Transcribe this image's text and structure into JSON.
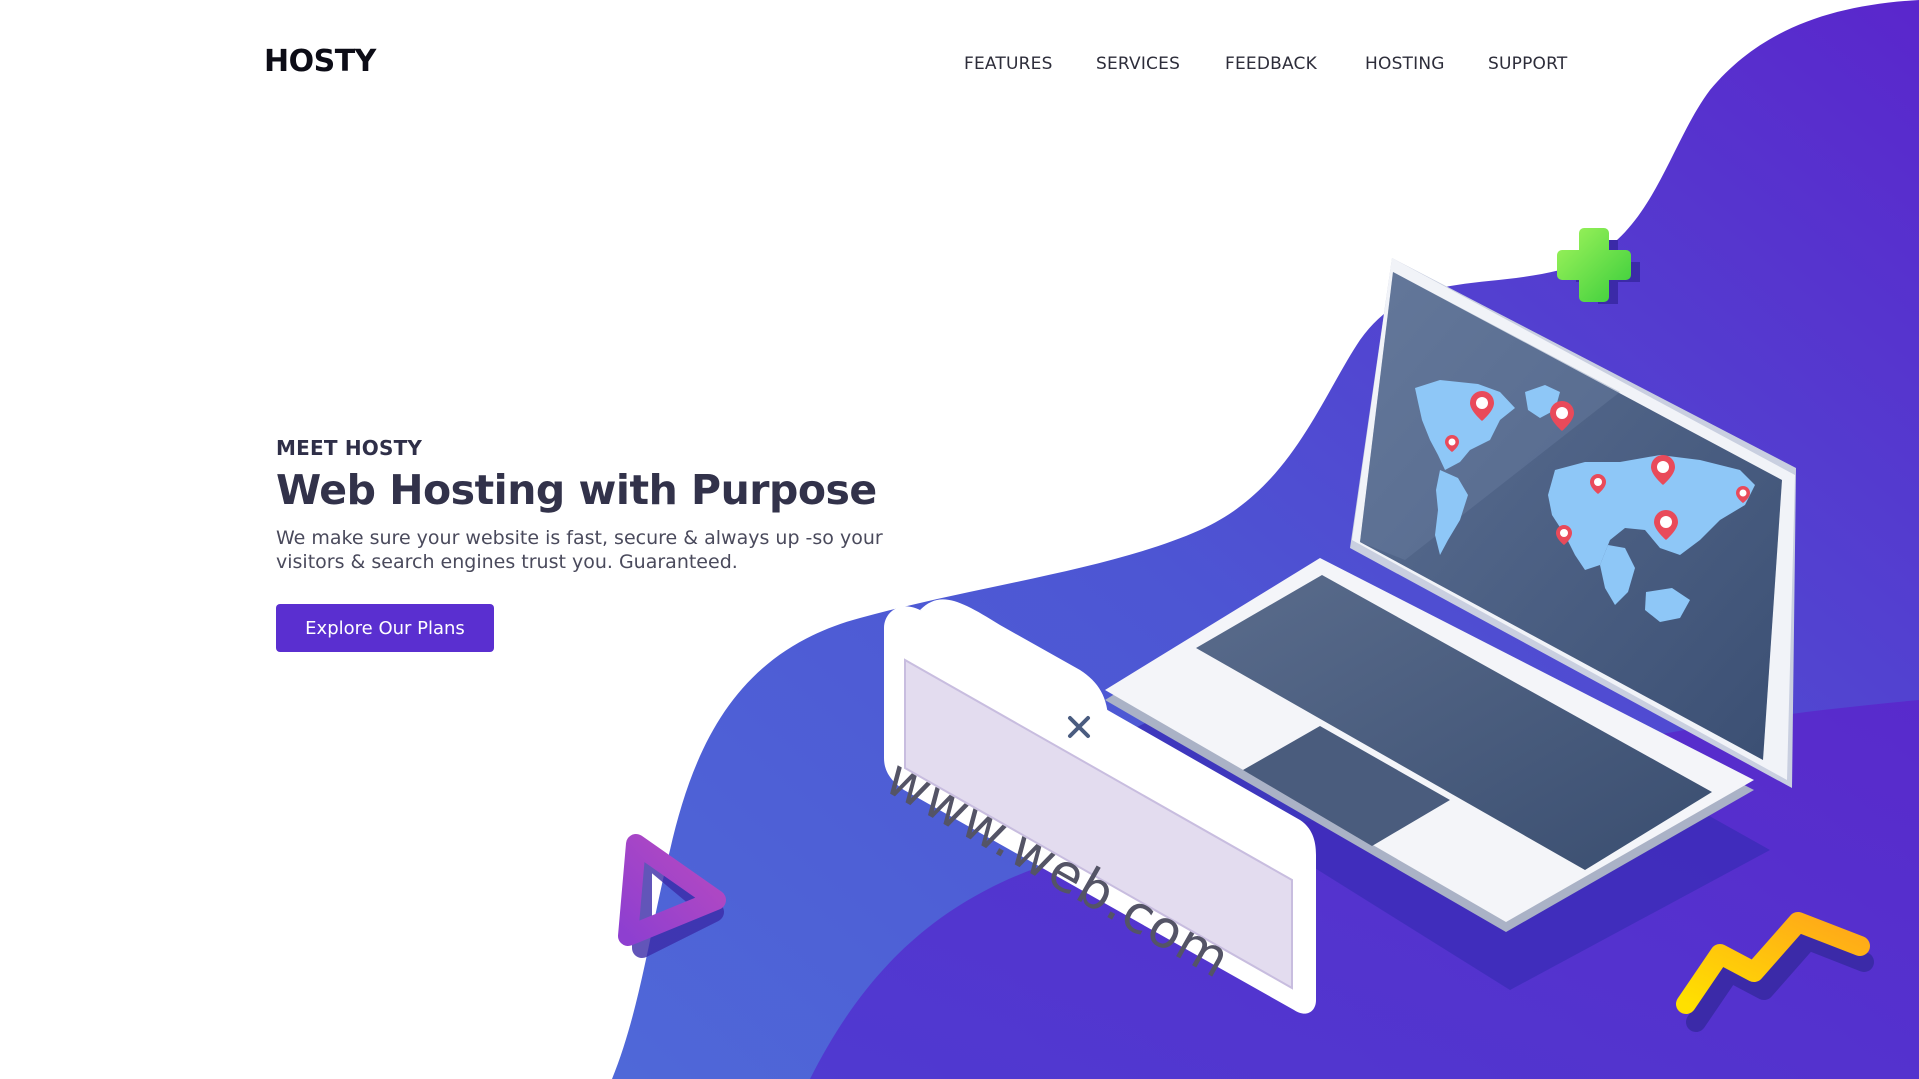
{
  "brand": {
    "name": "HOSTY"
  },
  "nav": {
    "items": [
      {
        "label": "FEATURES"
      },
      {
        "label": "SERVICES"
      },
      {
        "label": "FEEDBACK"
      },
      {
        "label": "HOSTING"
      },
      {
        "label": "SUPPORT"
      }
    ]
  },
  "hero": {
    "eyebrow": "MEET HOSTY",
    "headline": "Web Hosting with Purpose",
    "description": "We make sure your website is fast, secure & always up -so your visitors & search engines trust you. Guaranteed.",
    "cta_label": "Explore Our Plans"
  },
  "illustration": {
    "url_bar_text": "www.web.com",
    "icons": [
      "green-plus-icon",
      "play-triangle-icon",
      "zigzag-icon",
      "close-x-icon",
      "map-pin-icon"
    ]
  },
  "colors": {
    "accent": "#5a2fd0",
    "blob_dark": "#5b27cc",
    "blob_light": "#4d6ad6",
    "map_land": "#8ec7f7",
    "screen": "#4f6282",
    "pin": "#e94a5a",
    "plus": "#6ee04a",
    "zigzag": "#ffc400",
    "triangle": "#9b43c9"
  }
}
